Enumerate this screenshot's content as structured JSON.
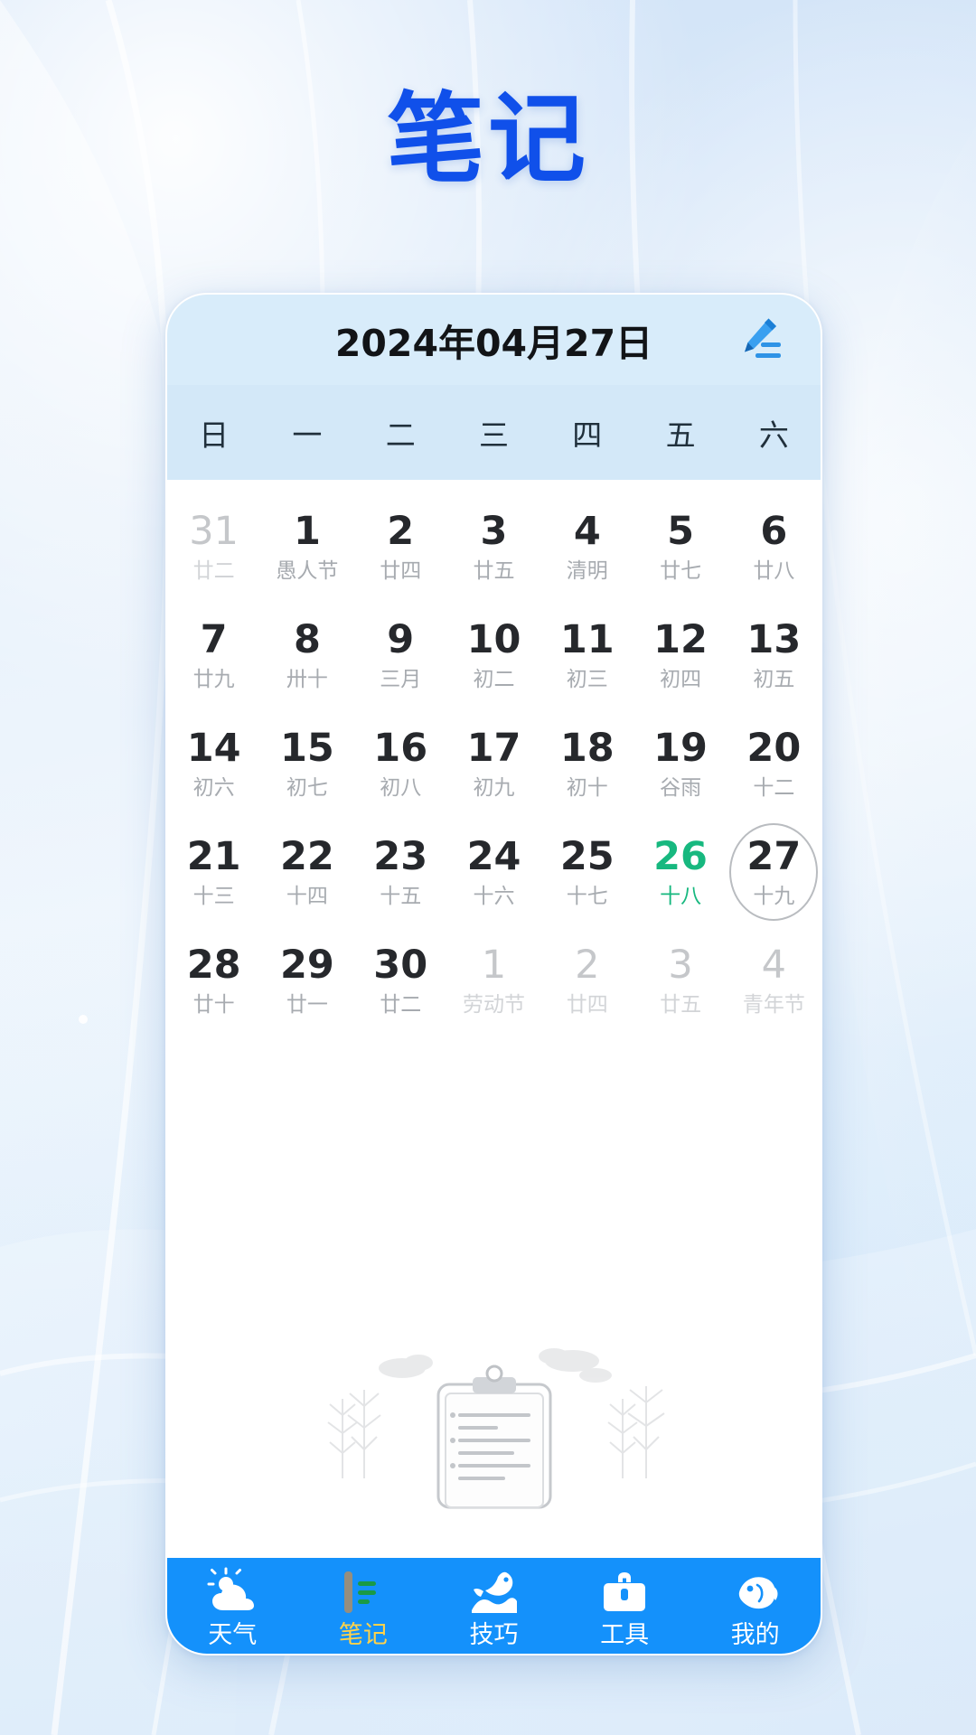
{
  "page": {
    "title": "笔记",
    "title_color": "#1050ea"
  },
  "calendar": {
    "header_date": "2024年04月27日",
    "edit_icon": "pencil-edit-icon",
    "weekdays": [
      "日",
      "一",
      "二",
      "三",
      "四",
      "五",
      "六"
    ],
    "today_color": "#17b87f",
    "weeks": [
      [
        {
          "num": "31",
          "lunar": "廿二",
          "state": "muted"
        },
        {
          "num": "1",
          "lunar": "愚人节",
          "state": "normal"
        },
        {
          "num": "2",
          "lunar": "廿四",
          "state": "normal"
        },
        {
          "num": "3",
          "lunar": "廿五",
          "state": "normal"
        },
        {
          "num": "4",
          "lunar": "清明",
          "state": "normal"
        },
        {
          "num": "5",
          "lunar": "廿七",
          "state": "normal"
        },
        {
          "num": "6",
          "lunar": "廿八",
          "state": "normal"
        }
      ],
      [
        {
          "num": "7",
          "lunar": "廿九",
          "state": "normal"
        },
        {
          "num": "8",
          "lunar": "卅十",
          "state": "normal"
        },
        {
          "num": "9",
          "lunar": "三月",
          "state": "normal"
        },
        {
          "num": "10",
          "lunar": "初二",
          "state": "normal"
        },
        {
          "num": "11",
          "lunar": "初三",
          "state": "normal"
        },
        {
          "num": "12",
          "lunar": "初四",
          "state": "normal"
        },
        {
          "num": "13",
          "lunar": "初五",
          "state": "normal"
        }
      ],
      [
        {
          "num": "14",
          "lunar": "初六",
          "state": "normal"
        },
        {
          "num": "15",
          "lunar": "初七",
          "state": "normal"
        },
        {
          "num": "16",
          "lunar": "初八",
          "state": "normal"
        },
        {
          "num": "17",
          "lunar": "初九",
          "state": "normal"
        },
        {
          "num": "18",
          "lunar": "初十",
          "state": "normal"
        },
        {
          "num": "19",
          "lunar": "谷雨",
          "state": "normal"
        },
        {
          "num": "20",
          "lunar": "十二",
          "state": "normal"
        }
      ],
      [
        {
          "num": "21",
          "lunar": "十三",
          "state": "normal"
        },
        {
          "num": "22",
          "lunar": "十四",
          "state": "normal"
        },
        {
          "num": "23",
          "lunar": "十五",
          "state": "normal"
        },
        {
          "num": "24",
          "lunar": "十六",
          "state": "normal"
        },
        {
          "num": "25",
          "lunar": "十七",
          "state": "normal"
        },
        {
          "num": "26",
          "lunar": "十八",
          "state": "today"
        },
        {
          "num": "27",
          "lunar": "十九",
          "state": "selected"
        }
      ],
      [
        {
          "num": "28",
          "lunar": "廿十",
          "state": "normal"
        },
        {
          "num": "29",
          "lunar": "廿一",
          "state": "normal"
        },
        {
          "num": "30",
          "lunar": "廿二",
          "state": "normal"
        },
        {
          "num": "1",
          "lunar": "劳动节",
          "state": "muted"
        },
        {
          "num": "2",
          "lunar": "廿四",
          "state": "muted"
        },
        {
          "num": "3",
          "lunar": "廿五",
          "state": "muted"
        },
        {
          "num": "4",
          "lunar": "青年节",
          "state": "muted"
        }
      ]
    ]
  },
  "empty_state": {
    "illustration": "clipboard-notes-empty-illustration"
  },
  "tabbar": {
    "background": "#1491fb",
    "active_label_color": "#ffd24a",
    "items": [
      {
        "label": "天气",
        "icon": "sun-cloud-icon",
        "active": false
      },
      {
        "label": "笔记",
        "icon": "notebook-icon",
        "active": true
      },
      {
        "label": "技巧",
        "icon": "jumping-fish-icon",
        "active": false
      },
      {
        "label": "工具",
        "icon": "toolbox-icon",
        "active": false
      },
      {
        "label": "我的",
        "icon": "fish-icon",
        "active": false
      }
    ]
  }
}
